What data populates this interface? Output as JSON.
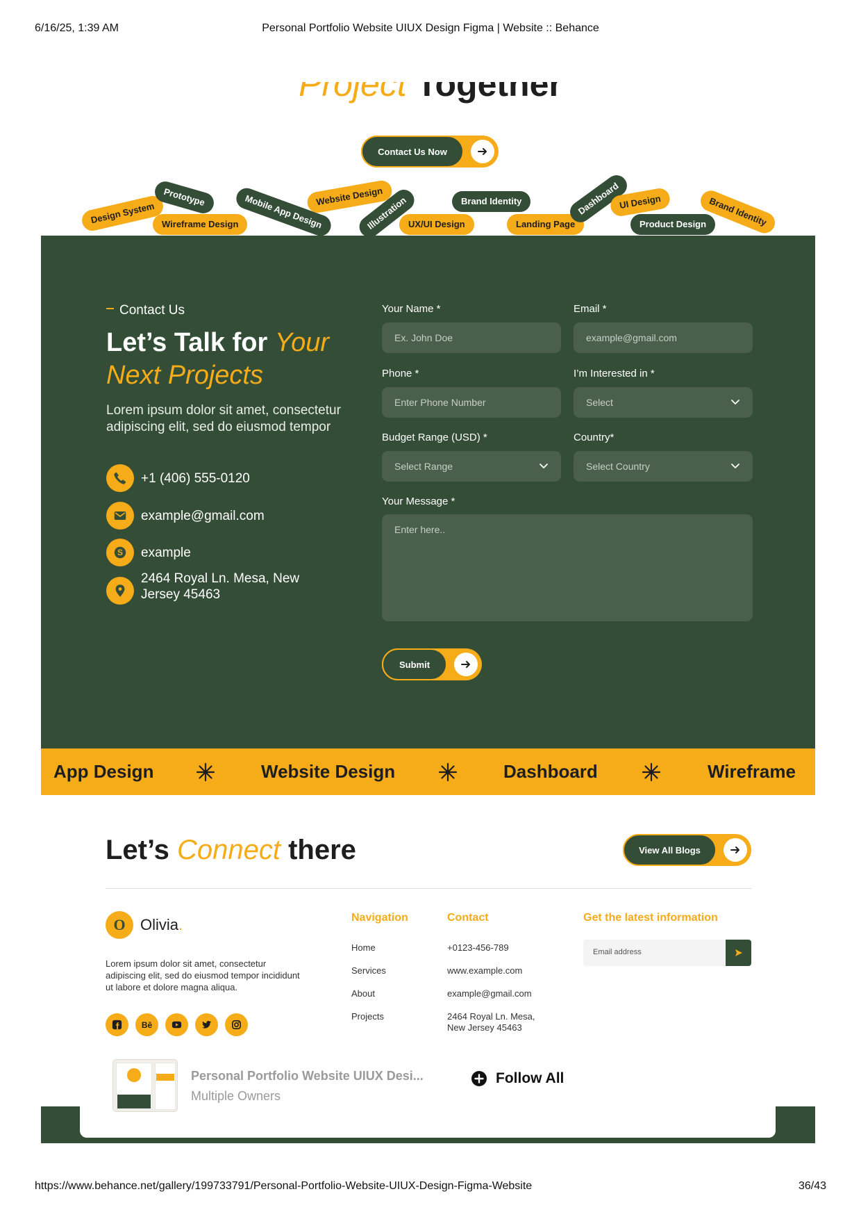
{
  "print": {
    "datetime": "6/16/25, 1:39 AM",
    "title": "Personal Portfolio Website UIUX Design Figma | Website :: Behance",
    "url": "https://www.behance.net/gallery/199733791/Personal-Portfolio-Website-UIUX-Design-Figma-Website",
    "page": "36/43"
  },
  "hero": {
    "title_accent": "Project",
    "title_rest": "Together",
    "cta_label": "Contact Us Now"
  },
  "tags": [
    "Design System",
    "Prototype",
    "Wireframe Design",
    "Mobile App Design",
    "Website Design",
    "Illustration",
    "UX/UI Design",
    "Brand Identity",
    "Landing Page",
    "Dashboard",
    "UI Design",
    "Product Design",
    "Brand Identity"
  ],
  "contact": {
    "eyebrow": "Contact Us",
    "heading_main": "Let’s Talk for ",
    "heading_accent": "Your Next Projects",
    "description": "Lorem ipsum dolor sit amet, consectetur adipiscing elit, sed do eiusmod tempor",
    "phone": "+1 (406) 555-0120",
    "email": "example@gmail.com",
    "skype": "example",
    "address": "2464 Royal Ln. Mesa, New Jersey 45463"
  },
  "form": {
    "name_label": "Your Name *",
    "name_placeholder": "Ex. John Doe",
    "email_label": "Email *",
    "email_placeholder": "example@gmail.com",
    "phone_label": "Phone *",
    "phone_placeholder": "Enter Phone Number",
    "interest_label": "I’m Interested in *",
    "interest_value": "Select",
    "budget_label": "Budget Range (USD) *",
    "budget_value": "Select Range",
    "country_label": "Country*",
    "country_value": "Select Country",
    "message_label": "Your Message *",
    "message_placeholder": "Enter here..",
    "submit_label": "Submit"
  },
  "marquee": [
    "App Design",
    "Website Design",
    "Dashboard",
    "Wireframe"
  ],
  "connect": {
    "title_pre": "Let’s ",
    "title_accent": "Connect",
    "title_post": " there",
    "blogs_label": "View All Blogs"
  },
  "footer": {
    "logo_letter": "O",
    "brand": "Olivia",
    "brand_dot": ".",
    "description": "Lorem ipsum dolor sit amet, consectetur adipiscing elit, sed do eiusmod tempor incididunt ut labore et dolore magna aliqua.",
    "socials": [
      "facebook-icon",
      "behance-icon",
      "youtube-icon",
      "twitter-icon",
      "instagram-icon"
    ],
    "behance_text": "Bē",
    "nav_heading": "Navigation",
    "nav_links": [
      "Home",
      "Services",
      "About",
      "Projects"
    ],
    "contact_heading": "Contact",
    "contact_lines": [
      "+0123-456-789",
      "www.example.com",
      "example@gmail.com",
      "2464 Royal Ln. Mesa, New Jersey 45463"
    ],
    "news_heading": "Get the latest information",
    "news_placeholder": "Email address"
  },
  "owner_bar": {
    "project_title": "Personal Portfolio Website UIUX Desi...",
    "owners": "Multiple Owners",
    "follow_label": "Follow All"
  },
  "colors": {
    "accent": "#f6ac19",
    "dark_green": "#344d37",
    "field": "#4a5f4c"
  }
}
